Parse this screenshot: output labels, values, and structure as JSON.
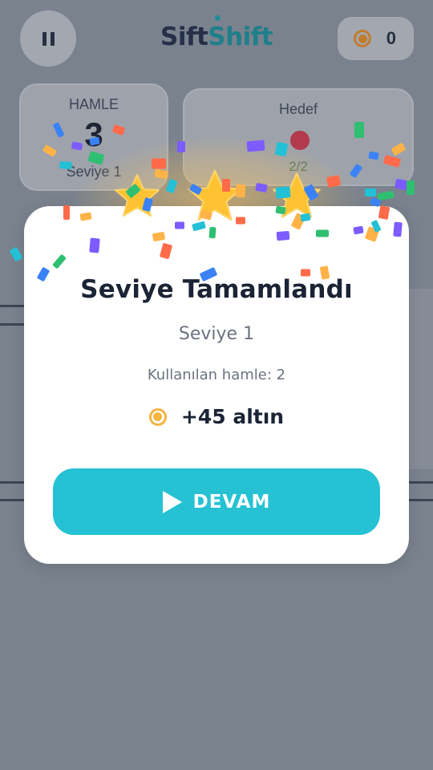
{
  "header": {
    "logo_part1": "Sift",
    "logo_part2": "Shift",
    "coins": "0"
  },
  "stats": {
    "moves_label": "HAMLE",
    "moves_value": "3",
    "level_label": "Seviye 1",
    "goal_label": "Hedef",
    "goal_progress": "2/2"
  },
  "modal": {
    "title": "Seviye Tamamlandı",
    "level": "Seviye 1",
    "moves_used": "Kullanılan hamle: 2",
    "reward": "+45 altın",
    "continue_label": "DEVAM",
    "stars_earned": 3
  },
  "colors": {
    "accent": "#26c2d3",
    "coin": "#f4b541",
    "star": "#ffc233",
    "goal_ball": "#b23a4c",
    "overlay_bg": "#7d8591"
  },
  "icons": {
    "pause": "pause-icon",
    "coin": "coin-icon",
    "play": "play-icon",
    "star": "star-icon"
  }
}
